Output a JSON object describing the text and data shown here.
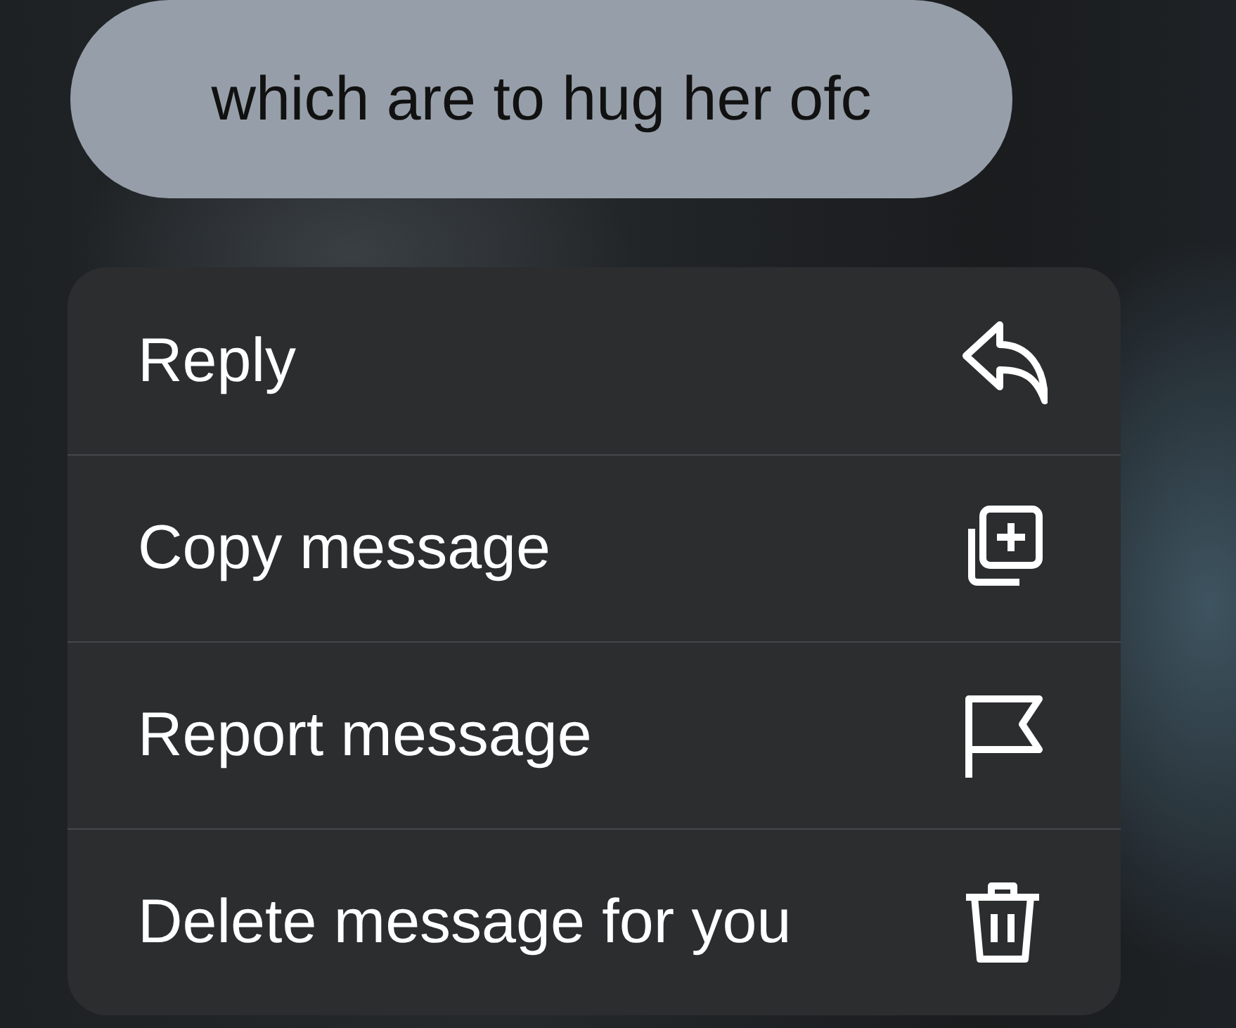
{
  "message": {
    "text": "which are to hug her ofc"
  },
  "menu": {
    "items": [
      {
        "label": "Reply",
        "kind": "reply"
      },
      {
        "label": "Copy message",
        "kind": "copy"
      },
      {
        "label": "Report message",
        "kind": "report"
      },
      {
        "label": "Delete message for you",
        "kind": "delete"
      }
    ]
  }
}
